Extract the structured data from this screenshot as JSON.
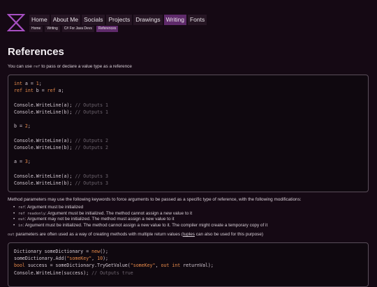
{
  "nav": {
    "items": [
      "Home",
      "About Me",
      "Socials",
      "Projects",
      "Drawings",
      "Writing",
      "Fonts"
    ],
    "active": "Writing"
  },
  "breadcrumb": [
    "Home",
    "Writing",
    "C# For Java Devs",
    "References"
  ],
  "page": {
    "title": "References"
  },
  "intro": {
    "pre": "You can use ",
    "code": "ref",
    "post": " to pass or declare a value type as a reference"
  },
  "code1": [
    [
      [
        "kw",
        "int"
      ],
      [
        "",
        "a = "
      ],
      [
        "num",
        "1"
      ],
      [
        "",
        ";"
      ]
    ],
    [
      [
        "kw",
        "ref int"
      ],
      [
        "",
        "b = "
      ],
      [
        "kw",
        "ref"
      ],
      [
        "",
        "a;"
      ]
    ],
    [],
    [
      [
        "",
        "Console.WriteLine(a); "
      ],
      [
        "cm",
        "// Outputs 1"
      ]
    ],
    [
      [
        "",
        "Console.WriteLine(b); "
      ],
      [
        "cm",
        "// Outputs 1"
      ]
    ],
    [],
    [
      [
        "",
        "b = "
      ],
      [
        "num",
        "2"
      ],
      [
        "",
        ";"
      ]
    ],
    [],
    [
      [
        "",
        "Console.WriteLine(a); "
      ],
      [
        "cm",
        "// Outputs 2"
      ]
    ],
    [
      [
        "",
        "Console.WriteLine(b); "
      ],
      [
        "cm",
        "// Outputs 2"
      ]
    ],
    [],
    [
      [
        "",
        "a = "
      ],
      [
        "num",
        "3"
      ],
      [
        "",
        ";"
      ]
    ],
    [],
    [
      [
        "",
        "Console.WriteLine(a); "
      ],
      [
        "cm",
        "// Outputs 3"
      ]
    ],
    [
      [
        "",
        "Console.WriteLine(b); "
      ],
      [
        "cm",
        "// Outputs 3"
      ]
    ]
  ],
  "method_params": {
    "text": "Method parameters may use the following keywords to force arguments to be passed as a specific type of reference, with the following modifications:"
  },
  "modifiers": [
    {
      "code": "ref",
      "text": ": Argument must be initialized"
    },
    {
      "code": "ref readonly",
      "text": ": Argument must be initialized. The method cannot assign a new value to it"
    },
    {
      "code": "out",
      "text": ": Argument may not be initialized. The method must assign a new value to it"
    },
    {
      "code": "in",
      "text": ": Argument must be initialized. The method cannot assign a new value to it. The compiler might create a temporary copy of it"
    }
  ],
  "out_params": {
    "code": "out",
    "text1": " parameters are often used as a way of creating methods with multiple return values (",
    "link": "tuples",
    "text2": " can also be used for this purpose)"
  },
  "code2": [
    [
      [
        "",
        "Dictionary someDictionary = "
      ],
      [
        "kw",
        "new"
      ],
      [
        "",
        "();"
      ]
    ],
    [
      [
        "",
        "someDictionary.Add("
      ],
      [
        "str",
        "\"someKey\""
      ],
      [
        "",
        ", "
      ],
      [
        "num",
        "10"
      ],
      [
        "",
        ");"
      ]
    ],
    [
      [
        "kw",
        "bool"
      ],
      [
        "",
        "success = someDictionary.TryGetValue("
      ],
      [
        "str",
        "\"someKey\""
      ],
      [
        "",
        ", "
      ],
      [
        "kw",
        "out int"
      ],
      [
        "",
        "returnVal);"
      ]
    ],
    [
      [
        "",
        "Console.WriteLine(success); "
      ],
      [
        "cm",
        "// Outputs true"
      ]
    ]
  ],
  "colors": {
    "background": "#150914",
    "accent": "#5e2a6a",
    "keyword": "#e88a4a",
    "comment": "#6f6670"
  }
}
